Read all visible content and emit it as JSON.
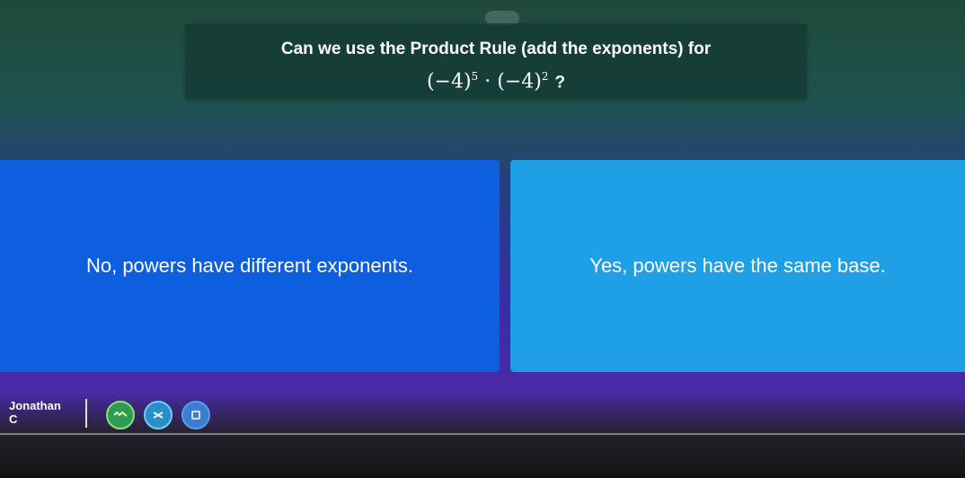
{
  "question": {
    "text": "Can we use the Product Rule (add the exponents) for",
    "base1": "(−4)",
    "exp1": "5",
    "dot": "·",
    "base2": "(−4)",
    "exp2": "2",
    "mark": "?"
  },
  "answers": {
    "left": "No, powers have different exponents.",
    "right": "Yes, powers have the same base."
  },
  "player": {
    "name": "Jonathan",
    "sub": "C"
  },
  "colors": {
    "answer_left": "#0e5fe0",
    "answer_right": "#1e9fe6"
  }
}
